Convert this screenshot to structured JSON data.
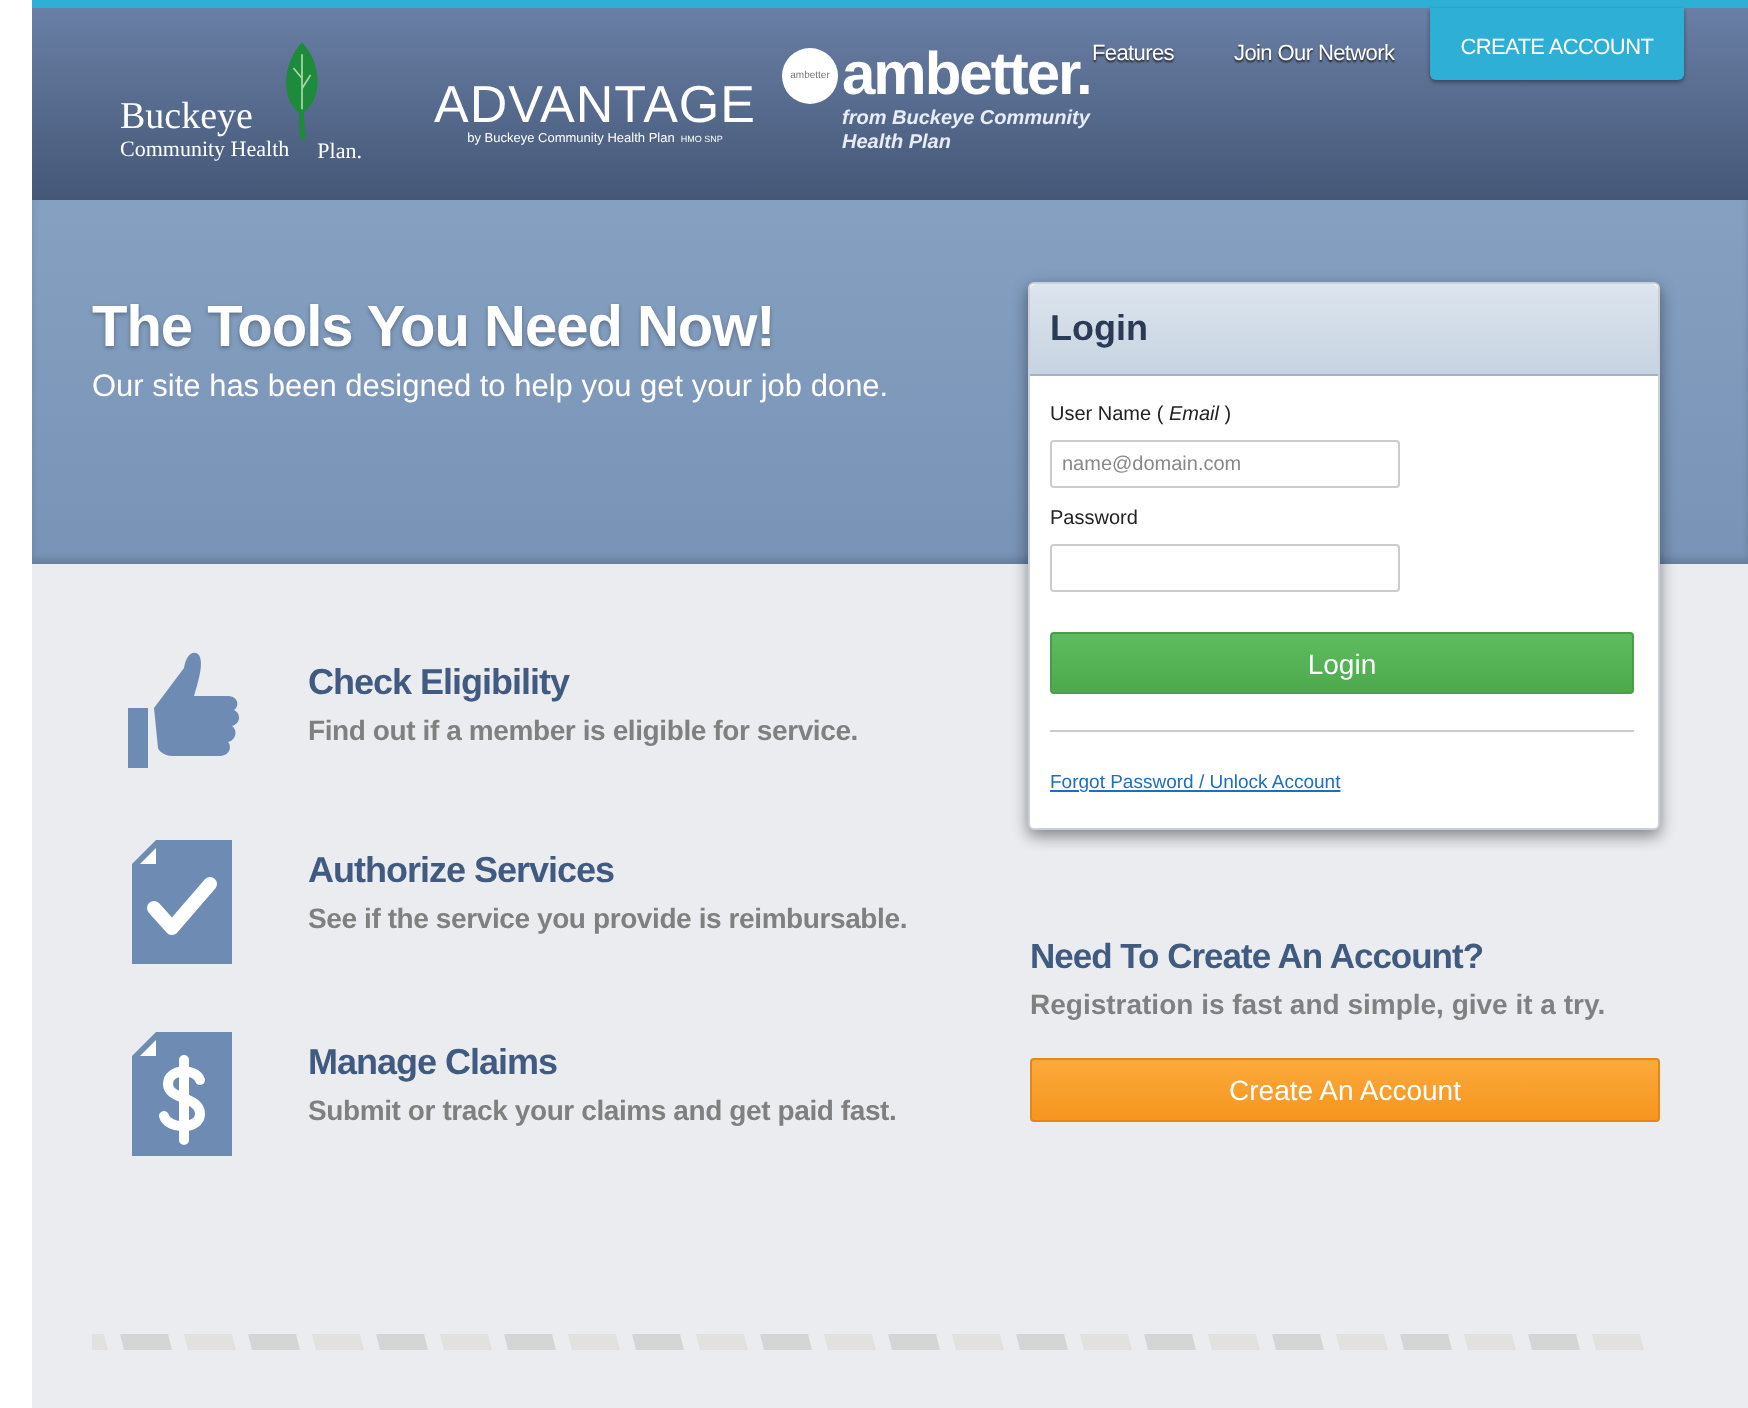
{
  "header": {
    "logos": [
      {
        "kind": "buckeye",
        "name": "Buckeye",
        "subtitle": "Community Health",
        "suffix": "Plan."
      },
      {
        "kind": "advantage",
        "name": "ADVANTAGE",
        "subtitle": "by Buckeye Community Health Plan",
        "suffix": "HMO SNP"
      },
      {
        "kind": "ambetter",
        "badge": "ambetter",
        "name": "ambetter.",
        "subtitle": "from Buckeye Community Health Plan"
      }
    ],
    "nav": [
      {
        "kind": "link",
        "label": "Features"
      },
      {
        "kind": "link",
        "label": "Join Our Network"
      },
      {
        "kind": "button",
        "label": "CREATE ACCOUNT"
      }
    ]
  },
  "hero": {
    "title": "The Tools You Need Now!",
    "subtitle": "Our site has been designed to help you get your job done."
  },
  "features": [
    {
      "kind": "thumb",
      "title": "Check Eligibility",
      "text": "Find out if a member is eligible for service."
    },
    {
      "kind": "check",
      "title": "Authorize Services",
      "text": "See if the service you provide is reimbursable."
    },
    {
      "kind": "dollar",
      "title": "Manage Claims",
      "text": "Submit or track your claims and get paid fast."
    }
  ],
  "login": {
    "title": "Login",
    "username_label": "User Name  ( *Email* )",
    "username_placeholder": "name@domain.com",
    "password_label": "Password",
    "button": "Login",
    "forgot_link": "Forgot Password / Unlock Account"
  },
  "signup": {
    "title": "Need To Create An Account?",
    "text": "Registration is fast and simple, give it a try.",
    "button": "Create An Account"
  }
}
